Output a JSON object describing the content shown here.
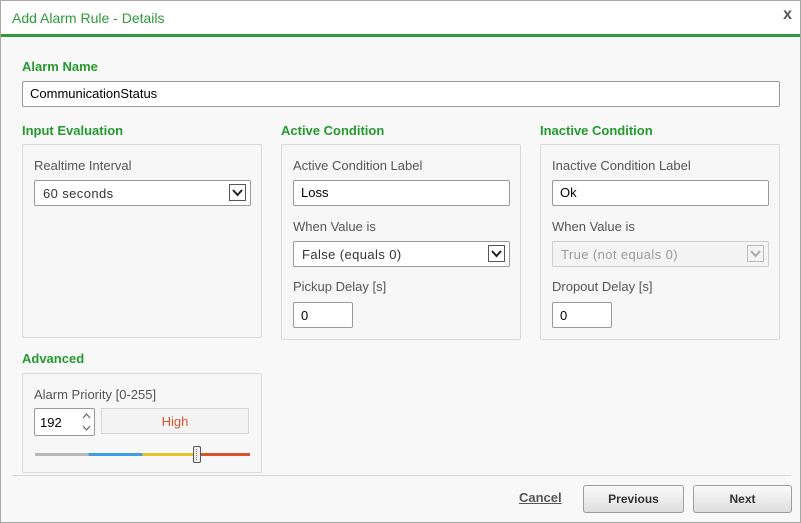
{
  "dialog": {
    "title": "Add Alarm Rule - Details",
    "close_glyph": "x"
  },
  "alarm_name": {
    "label": "Alarm Name",
    "value": "CommunicationStatus"
  },
  "input_evaluation": {
    "title": "Input Evaluation",
    "interval_label": "Realtime Interval",
    "interval_value": "60 seconds"
  },
  "active_condition": {
    "title": "Active Condition",
    "label_field_label": "Active Condition Label",
    "label_value": "Loss",
    "when_label": "When Value is",
    "when_value": "False (equals 0)",
    "delay_label": "Pickup Delay [s]",
    "delay_value": "0"
  },
  "inactive_condition": {
    "title": "Inactive Condition",
    "label_field_label": "Inactive Condition Label",
    "label_value": "Ok",
    "when_label": "When Value is",
    "when_value": "True (not equals 0)",
    "delay_label": "Dropout Delay [s]",
    "delay_value": "0"
  },
  "advanced": {
    "title": "Advanced",
    "priority_label": "Alarm Priority [0-255]",
    "priority_value": "192",
    "priority_level": "High",
    "priority_level_color": "#d9532c",
    "slider_value": 192,
    "slider_max": 255,
    "slider_colors": [
      "#b9b9b9",
      "#3d9fe0",
      "#e6c52a",
      "#d9532c"
    ]
  },
  "footer": {
    "cancel": "Cancel",
    "previous": "Previous",
    "next": "Next"
  },
  "colors": {
    "accent": "#2e9a3a",
    "section_title": "#239a2d"
  }
}
